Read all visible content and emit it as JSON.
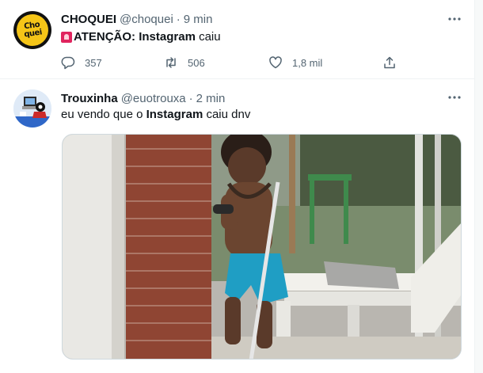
{
  "tweets": [
    {
      "display_name": "CHOQUEI",
      "handle": "@choquei",
      "separator": "·",
      "time": "9 min",
      "text_prefix": "ATENÇÃO: ",
      "text_bold": "Instagram",
      "text_suffix": " caiu",
      "avatar_text": [
        "Cho",
        "quei"
      ],
      "replies": "357",
      "retweets": "506",
      "likes": "1,8 mil"
    },
    {
      "display_name": "Trouxinha",
      "handle": "@euotrouxa",
      "separator": "·",
      "time": "2 min",
      "text_prefix": "eu vendo que o ",
      "text_bold": "Instagram",
      "text_suffix": " caiu dnv"
    }
  ],
  "icons": {
    "more": "more-horizontal-icon",
    "reply": "reply-icon",
    "retweet": "retweet-icon",
    "like": "heart-icon",
    "share": "share-icon",
    "siren": "siren-emoji-icon"
  },
  "colors": {
    "text": "#0f1419",
    "secondary": "#536471",
    "border": "#eff3f4",
    "choquei_yellow": "#f5c518",
    "siren_red": "#e0245e"
  }
}
